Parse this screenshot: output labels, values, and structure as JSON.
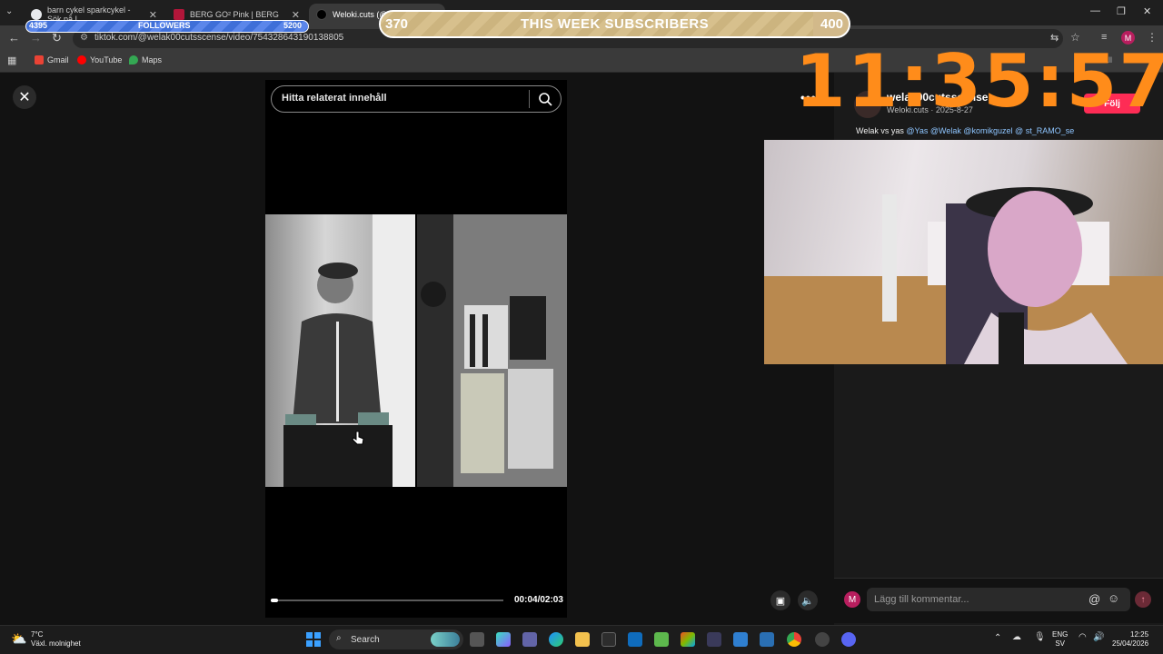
{
  "browser": {
    "tabs": [
      {
        "title": "barn cykel sparkcykel - Sök på I",
        "active": false
      },
      {
        "title": "BERG GO² Pink | BERG",
        "active": false
      },
      {
        "title": "Weloki.cuts (@w",
        "active": true
      }
    ],
    "url": "tiktok.com/@welak00cutsscense/video/754328643190138805",
    "bookmarks": [
      "Gmail",
      "YouTube",
      "Maps"
    ],
    "all_bookmarks": "All"
  },
  "overlay": {
    "followers_current": "4395",
    "followers_label": "FOLLOWERS",
    "followers_goal": "5200",
    "followers_progress": 0.845,
    "subs_current": "370",
    "subs_label": "THIS WEEK SUBSCRIBERS",
    "subs_goal": "400",
    "subs_progress": 0.925,
    "clock": "11:35:57"
  },
  "video": {
    "search_placeholder": "Hitta relaterat innehåll",
    "timecode": "00:04/02:03",
    "progress": 0.033
  },
  "post": {
    "username": "welak00cutsscense",
    "subline": "Weloki.cuts · 2025-8-27",
    "follow_label": "Följ",
    "desc_prefix": "Welak vs yas ",
    "mentions": [
      "@Yas",
      "@Welak",
      "@komikguzel",
      "@",
      "st_RAMO_se"
    ],
    "comment_placeholder": "Lägg till kommentar...",
    "avatar_initial": "M"
  },
  "taskbar": {
    "weather_temp": "7°C",
    "weather_desc": "Växl. molnighet",
    "search_label": "Search",
    "lang": "ENG",
    "lang_sub": "SV",
    "time": "12:25",
    "date": "25/04/2026"
  },
  "colors": {
    "accent_tiktok": "#fe2c55",
    "clock": "#ff8c1a",
    "followers_bar": "#3f6fd8",
    "subs_bar": "#d2b98a"
  }
}
